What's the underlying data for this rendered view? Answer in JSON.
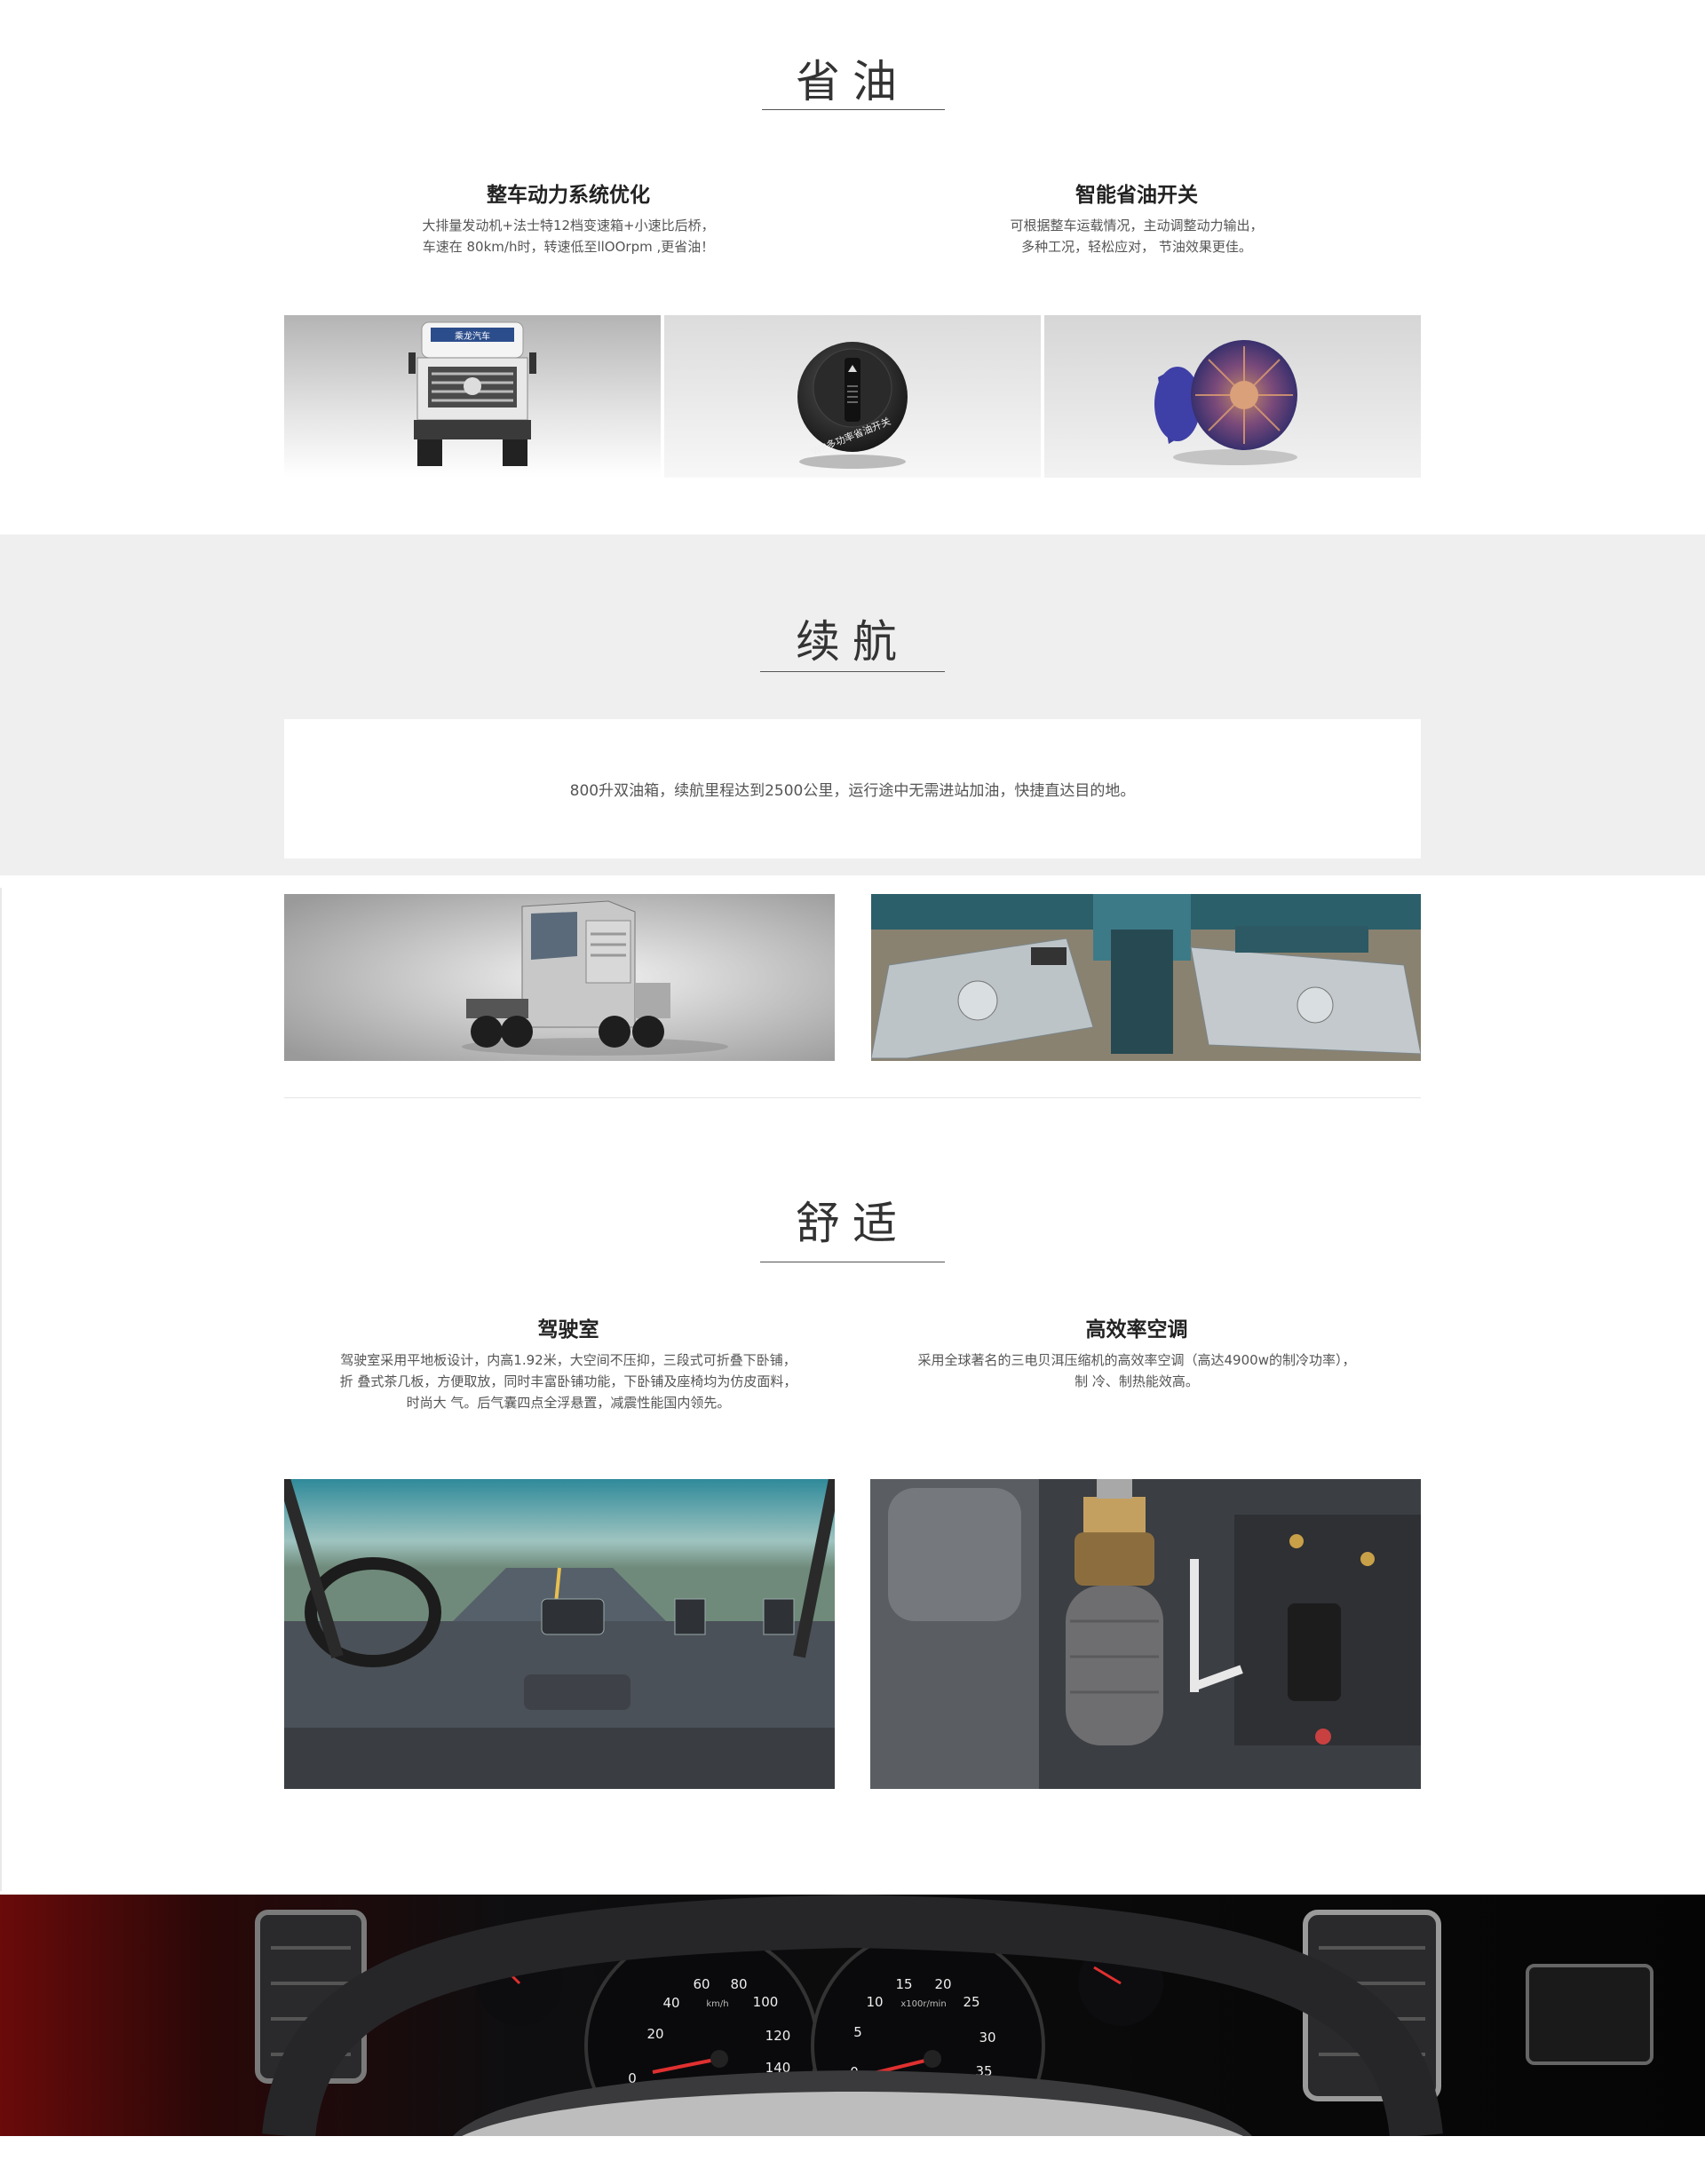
{
  "fuel": {
    "title": "省油",
    "features": [
      {
        "title": "整车动力系统优化",
        "lines": [
          "大排量发动机+法士特12档变速箱+小速比后桥，",
          "车速在 80km/h时，转速低至llOOrpm ,更省油！"
        ]
      },
      {
        "title": "智能省油开关",
        "lines": [
          "可根据整车运载情况，主动调整动力输出，",
          "多种工况，轻松应对， 节油效果更佳。"
        ]
      }
    ],
    "images": [
      {
        "name": "truck-front-photo",
        "brand_text": "乘龙汽车"
      },
      {
        "name": "fuel-saving-switch-photo",
        "dial_text": "WP多功率省油开关"
      },
      {
        "name": "fan-clutch-photo"
      }
    ]
  },
  "range": {
    "title": "续航",
    "text": "800升双油箱，续航里程达到2500公里，运行途中无需进站加油，快捷直达目的地。",
    "images": [
      {
        "name": "tractor-truck-photo"
      },
      {
        "name": "double-fuel-tank-photo"
      }
    ]
  },
  "comfort": {
    "title": "舒适",
    "features": [
      {
        "title": "驾驶室",
        "lines": [
          "驾驶室采用平地板设计，内高1.92米，大空间不压抑，三段式可折叠下卧铺，",
          "折 叠式茶几板，方便取放，同时丰富卧铺功能，下卧铺及座椅均为仿皮面料，",
          "时尚大 气。后气囊四点全浮悬置，减震性能国内领先。"
        ]
      },
      {
        "title": "高效率空调",
        "lines": [
          "采用全球著名的三电贝洱压缩机的高效率空调（高达4900w的制冷功率），",
          "制 冷、制热能效高。"
        ]
      }
    ],
    "images": [
      {
        "name": "cab-interior-photo"
      },
      {
        "name": "air-suspension-photo"
      }
    ]
  },
  "dashboard": {
    "speedo_unit": "km/h",
    "speedo_ticks": [
      "0",
      "20",
      "40",
      "60",
      "80",
      "100",
      "120",
      "140"
    ],
    "tacho_unit": "x100r/min",
    "tacho_ticks": [
      "0",
      "5",
      "10",
      "15",
      "20",
      "25",
      "30",
      "35"
    ]
  }
}
